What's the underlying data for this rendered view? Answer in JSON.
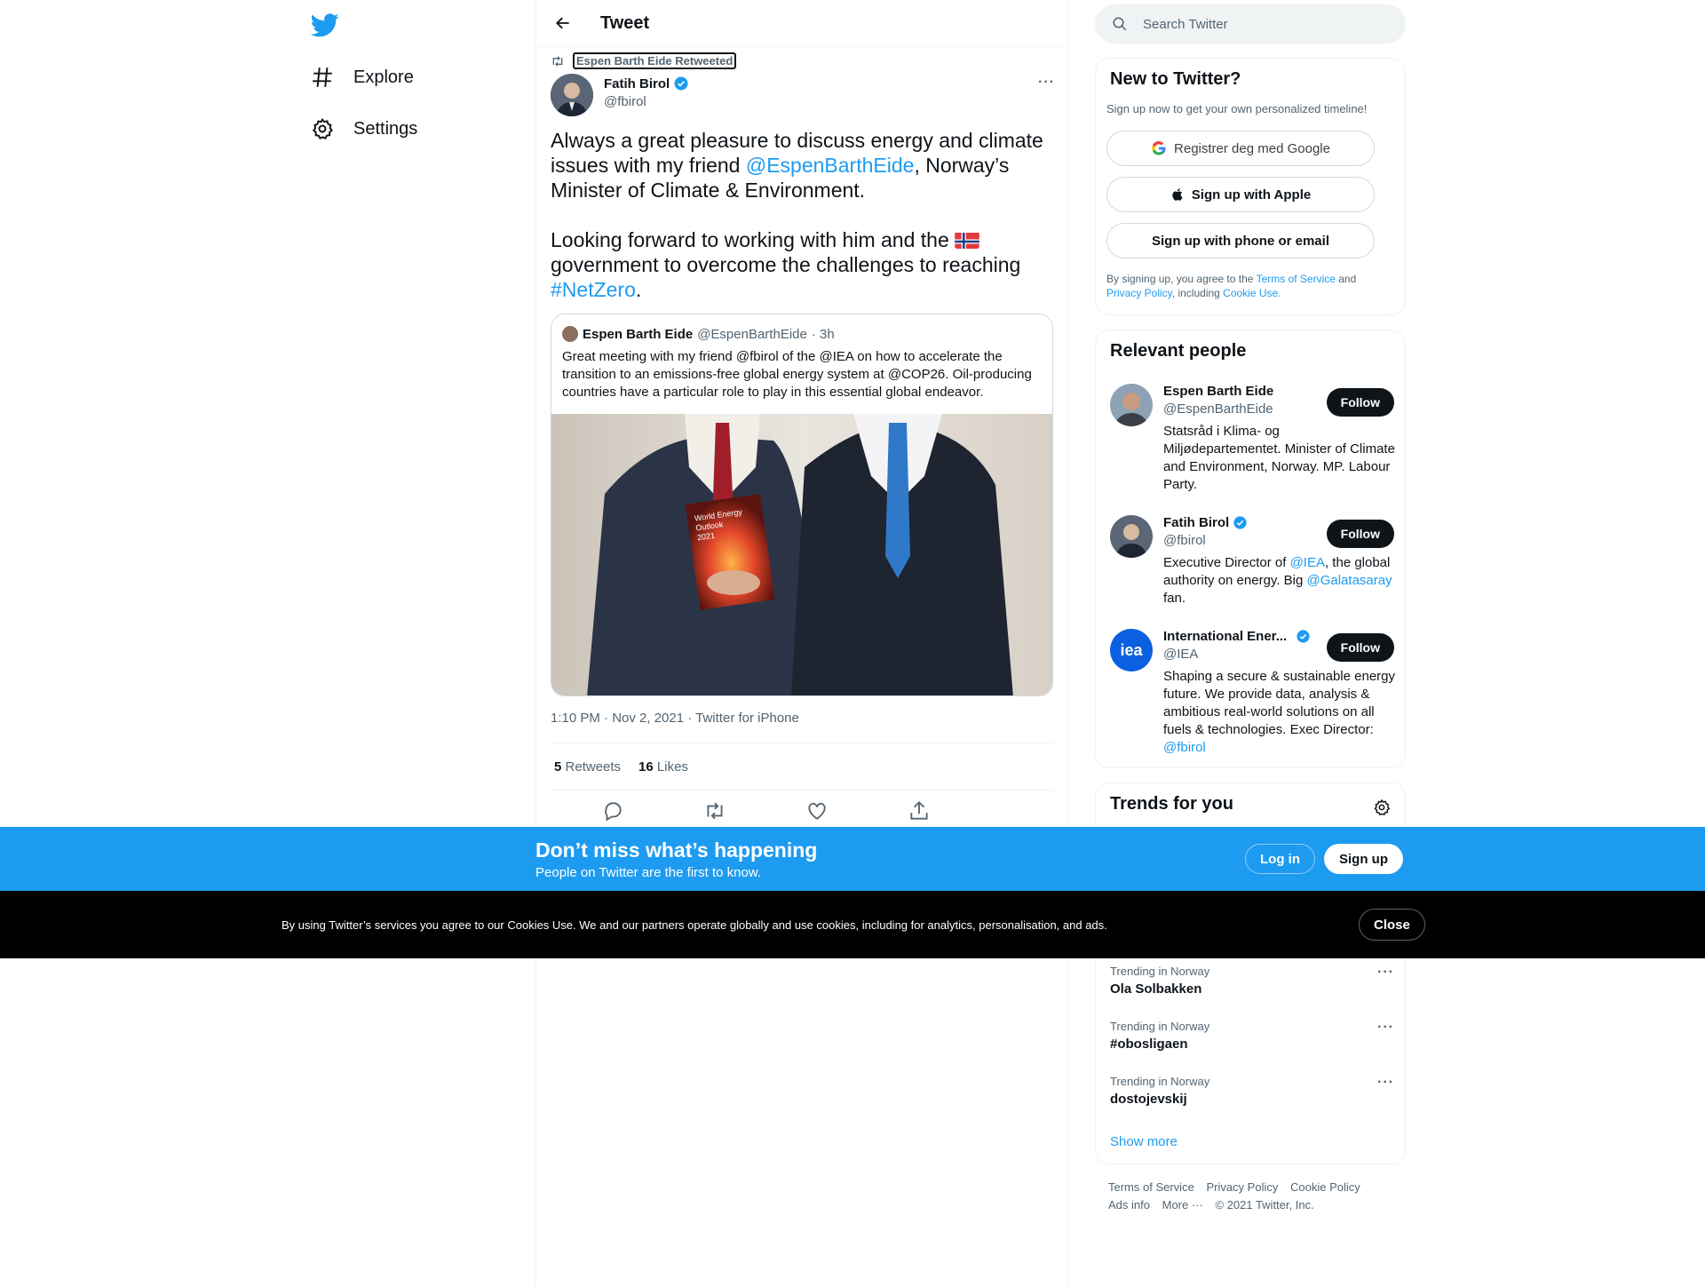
{
  "nav": {
    "items": [
      {
        "label": "Explore",
        "icon": "hashtag-icon"
      },
      {
        "label": "Settings",
        "icon": "gear-icon"
      }
    ]
  },
  "header": {
    "title": "Tweet"
  },
  "tweet": {
    "retweeted_by": "Espen Barth Eide Retweeted",
    "author_name": "Fatih Birol",
    "author_handle": "@fbirol",
    "text_p1_a": "Always a great pleasure to discuss energy and climate issues with my friend ",
    "text_p1_mention": "@EspenBarthEide",
    "text_p1_b": ", Norway’s Minister of Climate & Environment.",
    "text_p2_a": "Looking forward to working with him and the ",
    "text_p2_b": " government to overcome the challenges to reaching ",
    "text_p2_hashtag": "#NetZero",
    "text_p2_end": ".",
    "quote": {
      "name": "Espen Barth Eide",
      "handle": "@EspenBarthEide",
      "time": "· 3h",
      "text": "Great meeting with my friend @fbirol of the @IEA on how to accelerate the transition to an emissions-free global energy system at @COP26. Oil-producing countries have a particular role to play in this essential global endeavor.",
      "book_text": "World Energy Outlook 2021"
    },
    "meta": "1:10 PM · Nov 2, 2021 · Twitter for iPhone",
    "retweets_count": "5",
    "retweets_label": "Retweets",
    "likes_count": "16",
    "likes_label": "Likes"
  },
  "search": {
    "placeholder": "Search Twitter"
  },
  "new_to_twitter": {
    "title": "New to Twitter?",
    "subtitle": "Sign up now to get your own personalized timeline!",
    "google": "Registrer deg med Google",
    "apple": "Sign up with Apple",
    "phone": "Sign up with phone or email",
    "legal_a": "By signing up, you agree to the ",
    "terms": "Terms of Service",
    "legal_b": " and ",
    "privacy": "Privacy Policy",
    "legal_c": ", including ",
    "cookie": "Cookie Use."
  },
  "relevant": {
    "title": "Relevant people",
    "follow_label": "Follow",
    "people": [
      {
        "name": "Espen Barth Eide",
        "handle": "@EspenBarthEide",
        "bio": "Statsråd i Klima- og Miljødepartementet. Minister of Climate and Environment, Norway. MP. Labour Party."
      },
      {
        "name": "Fatih Birol",
        "handle": "@fbirol",
        "bio_a": "Executive Director of ",
        "bio_m1": "@IEA",
        "bio_b": ", the global authority on energy. Big ",
        "bio_m2": "@Galatasaray",
        "bio_c": " fan."
      },
      {
        "name": "International Ener...",
        "handle": "@IEA",
        "bio": "Shaping a secure & sustainable energy future. We provide data, analysis & ambitious real-world solutions on all fuels & technologies. Exec Director: ",
        "bio_m": "@fbirol",
        "logo_text": "iea"
      }
    ]
  },
  "trends": {
    "title": "Trends for you",
    "items": [
      {
        "label": "Trending in Norway",
        "name": "Ola Solbakken"
      },
      {
        "label": "Trending in Norway",
        "name": "#obosligaen"
      },
      {
        "label": "Trending in Norway",
        "name": "dostojevskij"
      }
    ],
    "show_more": "Show more"
  },
  "footer": {
    "links": [
      "Terms of Service",
      "Privacy Policy",
      "Cookie Policy",
      "Ads info",
      "More ···",
      "© 2021 Twitter, Inc."
    ]
  },
  "signup_bar": {
    "title": "Don’t miss what’s happening",
    "subtitle": "People on Twitter are the first to know.",
    "login": "Log in",
    "signup": "Sign up"
  },
  "cookie_bar": {
    "text": "By using Twitter’s services you agree to our Cookies Use. We and our partners operate globally and use cookies, including for analytics, personalisation, and ads.",
    "close": "Close"
  },
  "colors": {
    "accent": "#1d9bf0",
    "text": "#0f1419",
    "muted": "#536471",
    "cookie_bg": "#000000"
  }
}
